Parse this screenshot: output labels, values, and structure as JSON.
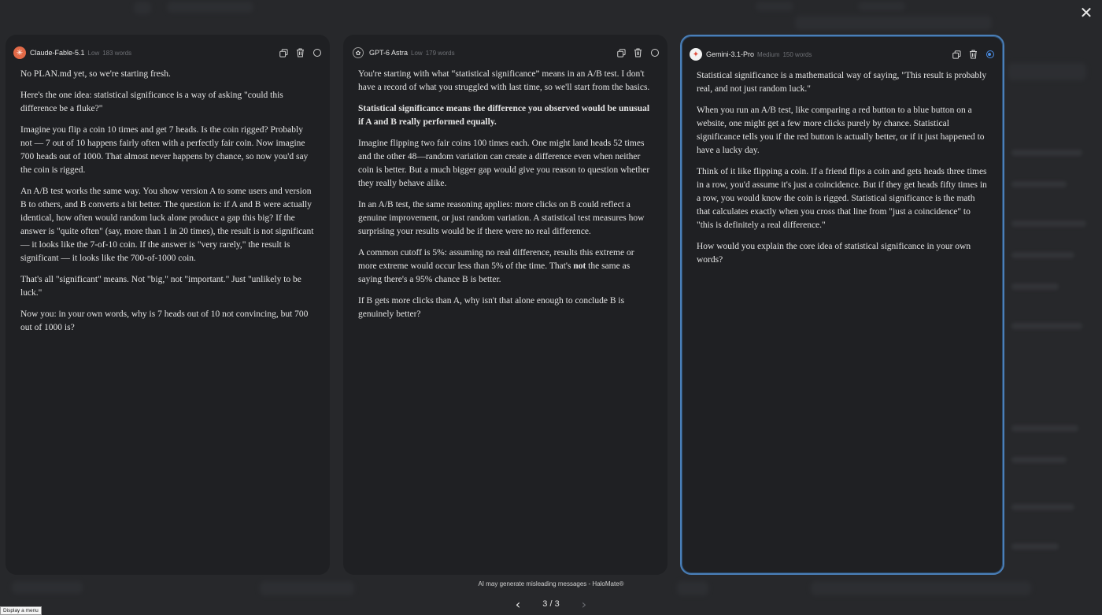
{
  "app": {
    "close_label": "✕"
  },
  "panels": [
    {
      "model": "Claude-Fable-5.1",
      "level": "Low",
      "words": "183 words",
      "icon": "claude-logo",
      "selected": false,
      "paragraphs": [
        "No PLAN.md yet, so we're starting fresh.",
        "Here's the one idea: statistical significance is a way of asking \"could this difference be a fluke?\"",
        "Imagine you flip a coin 10 times and get 7 heads. Is the coin rigged? Probably not — 7 out of 10 happens fairly often with a perfectly fair coin. Now imagine 700 heads out of 1000. That almost never happens by chance, so now you'd say the coin is rigged.",
        "An A/B test works the same way. You show version A to some users and version B to others, and B converts a bit better. The question is: if A and B were actually identical, how often would random luck alone produce a gap this big? If the answer is \"quite often\" (say, more than 1 in 20 times), the result is not significant — it looks like the 7-of-10 coin. If the answer is \"very rarely,\" the result is significant — it looks like the 700-of-1000 coin.",
        "That's all \"significant\" means. Not \"big,\" not \"important.\" Just \"unlikely to be luck.\"",
        "Now you: in your own words, why is 7 heads out of 10 not convincing, but 700 out of 1000 is?"
      ]
    },
    {
      "model": "GPT-6 Astra",
      "level": "Low",
      "words": "179 words",
      "icon": "gpt-logo",
      "selected": false,
      "p1": "You're starting with what “statistical significance” means in an A/B test. I don't have a record of what you struggled with last time, so we'll start from the basics.",
      "p2_bold": "Statistical significance means the difference you observed would be unusual if A and B really performed equally.",
      "p3": "Imagine flipping two fair coins 100 times each. One might land heads 52 times and the other 48—random variation can create a difference even when neither coin is better. But a much bigger gap would give you reason to question whether they really behave alike.",
      "p4": "In an A/B test, the same reasoning applies: more clicks on B could reflect a genuine improvement, or just random variation. A statistical test measures how surprising your results would be if there were no real difference.",
      "p5_a": "A common cutoff is 5%: assuming no real difference, results this extreme or more extreme would occur less than 5% of the time. That's ",
      "p5_bold": "not",
      "p5_b": " the same as saying there's a 95% chance B is better.",
      "p6": "If B gets more clicks than A, why isn't that alone enough to conclude B is genuinely better?"
    },
    {
      "model": "Gemini-3.1-Pro",
      "level": "Medium",
      "words": "150 words",
      "icon": "gemini-logo",
      "selected": true,
      "paragraphs": [
        "Statistical significance is a mathematical way of saying, \"This result is probably real, and not just random luck.\"",
        "When you run an A/B test, like comparing a red button to a blue button on a website, one might get a few more clicks purely by chance. Statistical significance tells you if the red button is actually better, or if it just happened to have a lucky day.",
        "Think of it like flipping a coin. If a friend flips a coin and gets heads three times in a row, you'd assume it's just a coincidence. But if they get heads fifty times in a row, you would know the coin is rigged. Statistical significance is the math that calculates exactly when you cross that line from \"just a coincidence\" to \"this is definitely a real difference.\"",
        "How would you explain the core idea of statistical significance in your own words?"
      ]
    }
  ],
  "footer": {
    "disclaimer": "AI may generate misleading messages - HaloMate®"
  },
  "pager": {
    "text": "3 / 3",
    "prev": "‹",
    "next": "›"
  },
  "status_tip": "Display a menu",
  "colors": {
    "accent": "#4a8ee6",
    "panel_bg": "#1f2023",
    "page_bg": "#27282b"
  }
}
